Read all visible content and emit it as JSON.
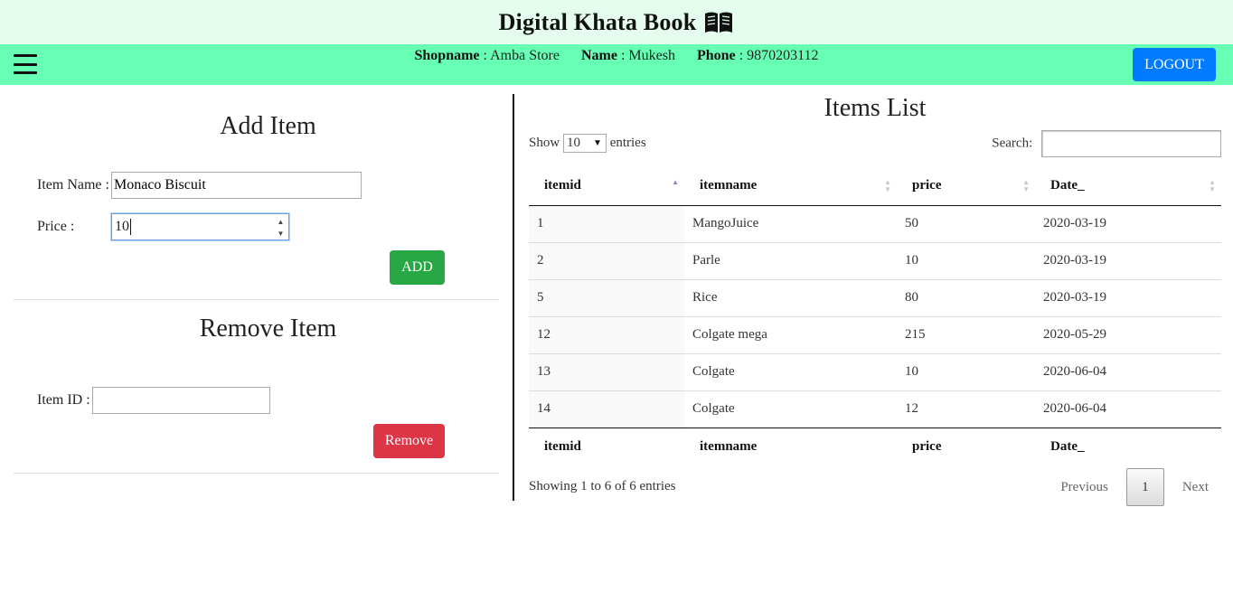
{
  "header": {
    "title": "Digital Khata Book",
    "icon": "open-book-icon"
  },
  "navbar": {
    "shopname_label": "Shopname",
    "shopname_value": "Amba Store",
    "name_label": "Name",
    "name_value": "Mukesh",
    "phone_label": "Phone",
    "phone_value": "9870203112",
    "logout_label": "LOGOUT",
    "menu_icon": "hamburger-menu-icon"
  },
  "add_item": {
    "title": "Add Item",
    "item_name_label": "Item Name :",
    "item_name_value": "Monaco Biscuit",
    "price_label": "Price :",
    "price_value": "10",
    "add_button": "ADD"
  },
  "remove_item": {
    "title": "Remove Item",
    "item_id_label": "Item ID :",
    "item_id_value": "",
    "remove_button": "Remove"
  },
  "items_list": {
    "title": "Items List",
    "show_label": "Show",
    "entries_label": "entries",
    "page_length": "10",
    "search_label": "Search:",
    "search_value": "",
    "columns": [
      "itemid",
      "itemname",
      "price",
      "Date_"
    ],
    "rows": [
      [
        "1",
        "MangoJuice",
        "50",
        "2020-03-19"
      ],
      [
        "2",
        "Parle",
        "10",
        "2020-03-19"
      ],
      [
        "5",
        "Rice",
        "80",
        "2020-03-19"
      ],
      [
        "12",
        "Colgate mega",
        "215",
        "2020-05-29"
      ],
      [
        "13",
        "Colgate",
        "10",
        "2020-06-04"
      ],
      [
        "14",
        "Colgate",
        "12",
        "2020-06-04"
      ]
    ],
    "info": "Showing 1 to 6 of 6 entries",
    "pagination": {
      "previous": "Previous",
      "current_page": "1",
      "next": "Next"
    }
  },
  "colors": {
    "header_bg": "#e4fdee",
    "navbar_bg": "#66ffb3",
    "logout_bg": "#007bff",
    "add_bg": "#28a745",
    "remove_bg": "#dc3545"
  }
}
